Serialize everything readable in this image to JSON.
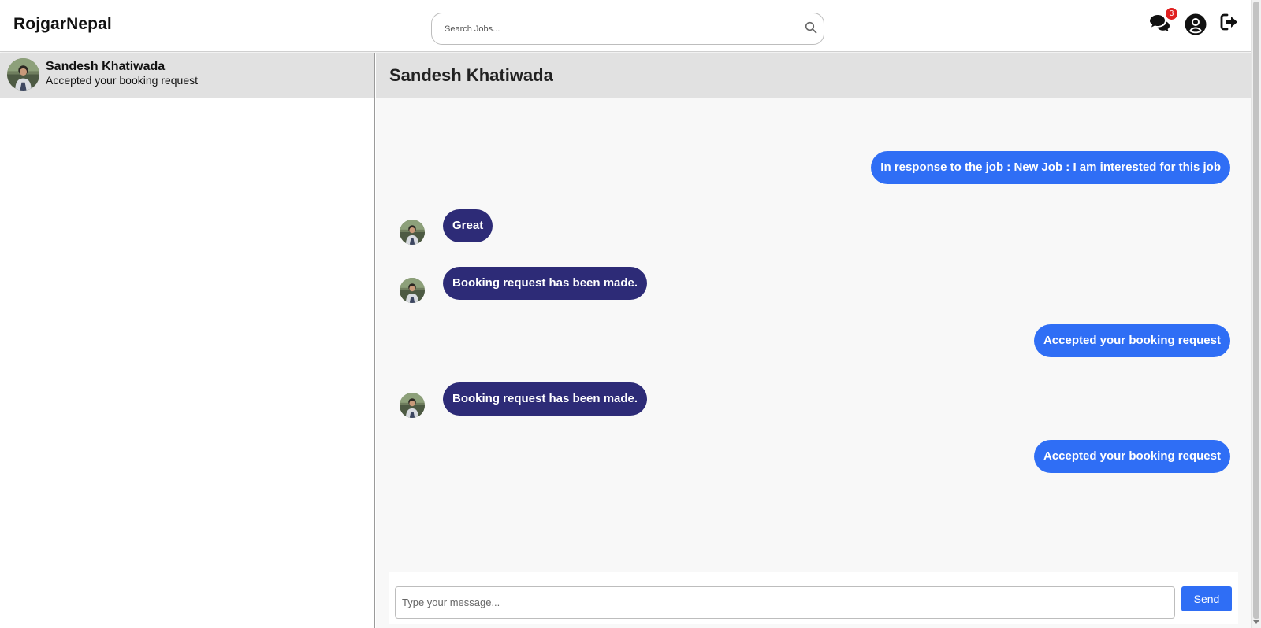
{
  "header": {
    "brand": "RojgarNepal",
    "search_placeholder": "Search Jobs...",
    "notification_count": "3",
    "icons": [
      "search-icon",
      "chat-icon",
      "user-circle-icon",
      "logout-icon"
    ]
  },
  "sidebar": {
    "conversations": [
      {
        "name": "Sandesh Khatiwada",
        "preview": "Accepted your booking request",
        "selected": true
      }
    ]
  },
  "chat": {
    "title": "Sandesh Khatiwada",
    "messages": [
      {
        "direction": "sent",
        "text": "In response to the job : New Job : I am interested for this job"
      },
      {
        "direction": "received",
        "text": "Great"
      },
      {
        "direction": "received",
        "text": "Booking request has been made."
      },
      {
        "direction": "sent",
        "text": "Accepted your booking request"
      },
      {
        "direction": "received",
        "text": "Booking request has been made."
      },
      {
        "direction": "sent",
        "text": "Accepted your booking request"
      }
    ],
    "composer": {
      "placeholder": "Type your message...",
      "send_label": "Send"
    }
  },
  "colors": {
    "sent_bubble": "#2f6ef5",
    "received_bubble": "#2d2b77",
    "header_band": "#e1e1e1",
    "badge": "#e02020"
  }
}
